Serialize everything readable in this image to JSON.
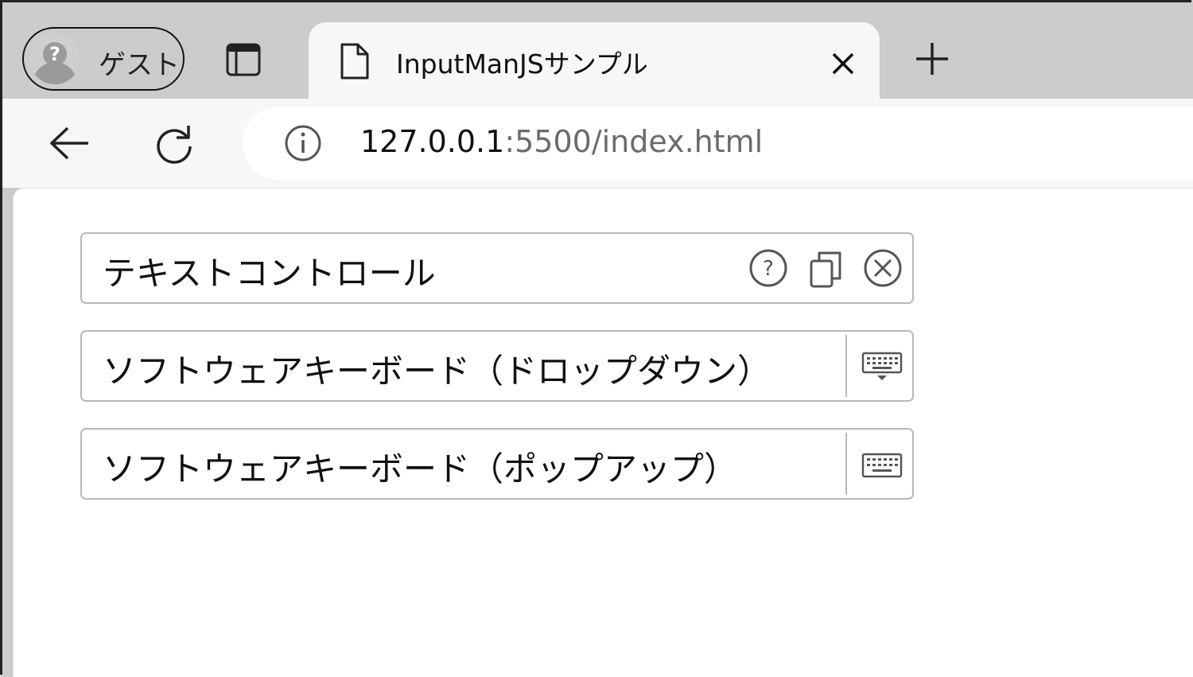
{
  "browser": {
    "profile_label": "ゲスト",
    "tab_title": "InputManJSサンプル",
    "url_host": "127.0.0.1",
    "url_rest": ":5500/index.html"
  },
  "fields": [
    {
      "value": "テキストコントロール",
      "buttons": [
        "help-icon",
        "copy-icon",
        "clear-icon"
      ]
    },
    {
      "value": "ソフトウェアキーボード（ドロップダウン）",
      "buttons": [
        "keyboard-dropdown-icon"
      ]
    },
    {
      "value": "ソフトウェアキーボード（ポップアップ）",
      "buttons": [
        "keyboard-icon"
      ]
    }
  ],
  "colors": {
    "tabstrip": "#cccccc",
    "toolbar": "#f7f7f7",
    "field_border": "#b8b8b8",
    "icon": "#555555"
  }
}
